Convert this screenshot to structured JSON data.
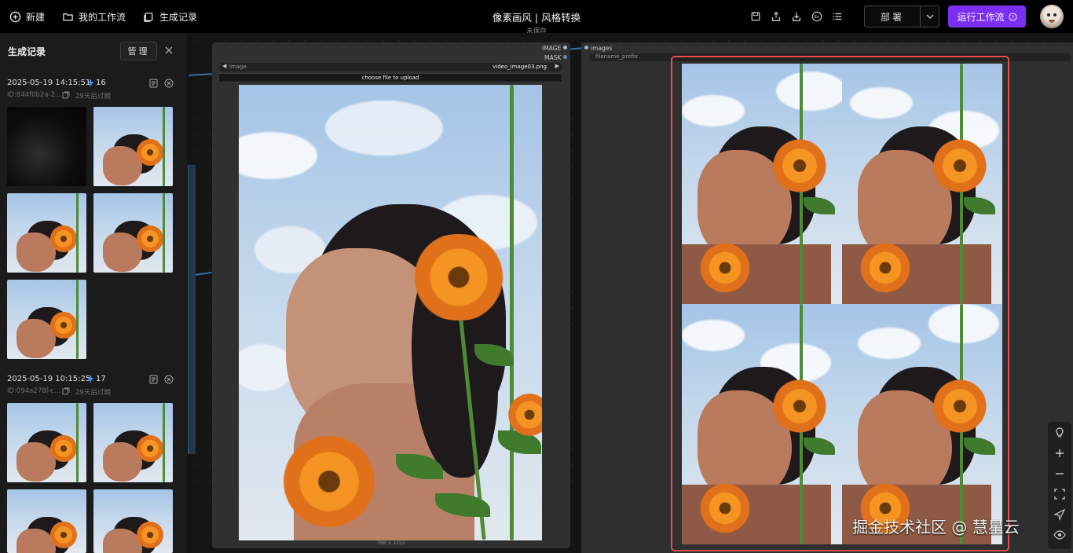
{
  "topbar": {
    "new_label": "新建",
    "workflows_label": "我的工作流",
    "history_label": "生成记录",
    "title": "像素画风 | 风格转换",
    "subtitle": "未保存",
    "deploy_label": "部署",
    "run_label": "运行工作流"
  },
  "sidebar": {
    "title": "生成记录",
    "manage_label": "管理",
    "groups": [
      {
        "date": "2025-05-19 14:15:51",
        "count": "16",
        "id": "ID:844f0b2a-2...",
        "expiry": "29天后过期"
      },
      {
        "date": "2025-05-19 10:15:25",
        "count": "17",
        "id": "ID:094a278f-c...",
        "expiry": "29天后过期"
      }
    ]
  },
  "node_left": {
    "port_image": "IMAGE",
    "port_mask": "MASK",
    "widget_label": "image",
    "widget_value": "video_image03.png",
    "upload_label": "choose file to upload",
    "caption": "768 × 1152"
  },
  "node_right": {
    "port_images": "images",
    "widget_label": "filename_prefix"
  },
  "watermark": "掘金技术社区 @ 慧星云",
  "colors": {
    "accent": "#7b2ff2",
    "selection": "#e35149",
    "lightning": "#3b9cff"
  }
}
